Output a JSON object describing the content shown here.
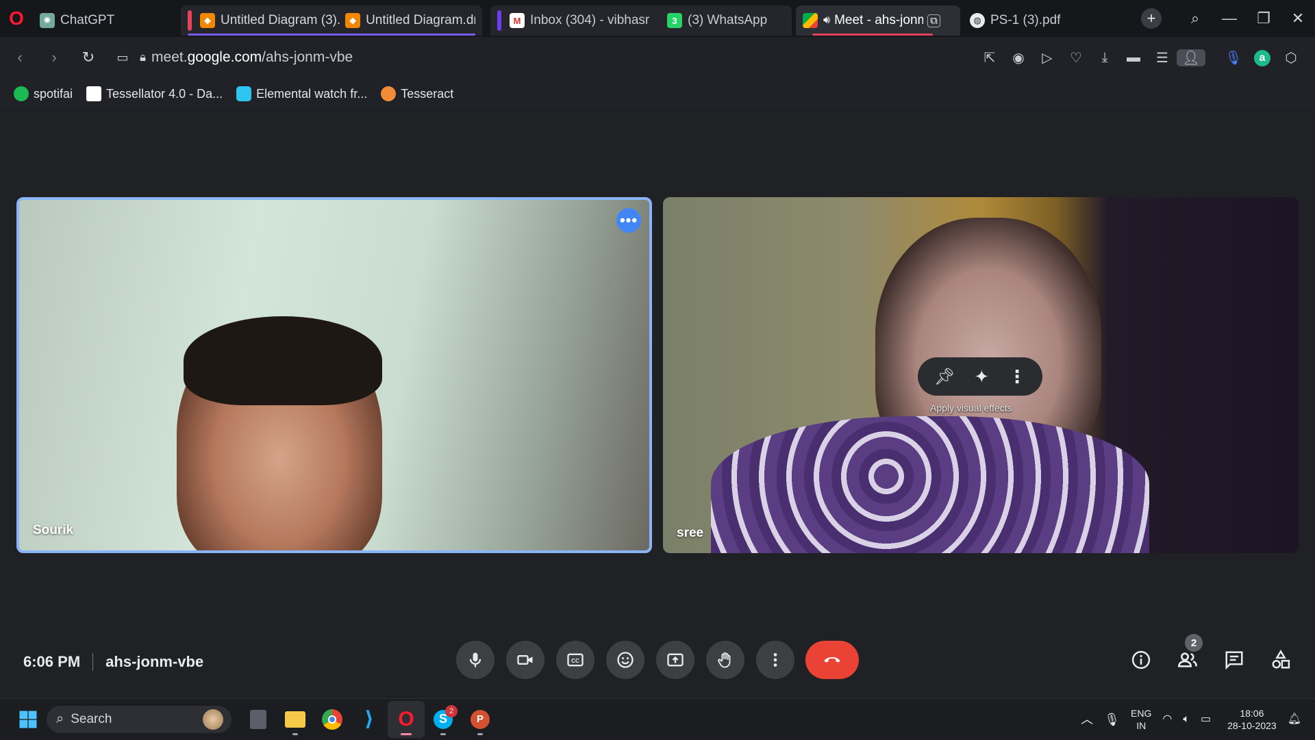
{
  "browser": {
    "tabs": [
      {
        "label": "ChatGPT",
        "icon": "chatgpt-icon"
      },
      {
        "label": "Untitled Diagram (3)..",
        "icon": "drawio-icon"
      },
      {
        "label": "Untitled Diagram.dra",
        "icon": "drawio-icon"
      },
      {
        "label": "Inbox (304) - vibhasr",
        "icon": "gmail-icon"
      },
      {
        "label": "(3) WhatsApp",
        "icon": "whatsapp-icon",
        "badge": "3"
      },
      {
        "label": "Meet - ahs-jonm",
        "icon": "meet-icon"
      },
      {
        "label": "PS-1 (3).pdf",
        "icon": "globe-icon"
      }
    ],
    "url_prefix": "meet.",
    "url_domain": "google.com",
    "url_path": "/ahs-jonm-vbe",
    "bookmarks": [
      {
        "label": "spotifai",
        "color": "#1db954"
      },
      {
        "label": "Tessellator 4.0 - Da...",
        "color": "#ffffff"
      },
      {
        "label": "Elemental watch fr...",
        "color": "#2ec4f0"
      },
      {
        "label": "Tesseract",
        "color": "#f28c38"
      }
    ]
  },
  "meet": {
    "participants": [
      {
        "name": "Sourik"
      },
      {
        "name": "sree"
      }
    ],
    "tile_menu_tooltip": "Apply visual effects",
    "time": "6:06 PM",
    "meeting_code": "ahs-jonm-vbe",
    "people_count": "2",
    "colors": {
      "accent": "#8ab4f8",
      "end_call": "#ea4335",
      "control_bg": "#3c4043"
    }
  },
  "taskbar": {
    "search_placeholder": "Search",
    "skype_badge": "2",
    "lang_top": "ENG",
    "lang_bottom": "IN",
    "time": "18:06",
    "date": "28-10-2023"
  }
}
